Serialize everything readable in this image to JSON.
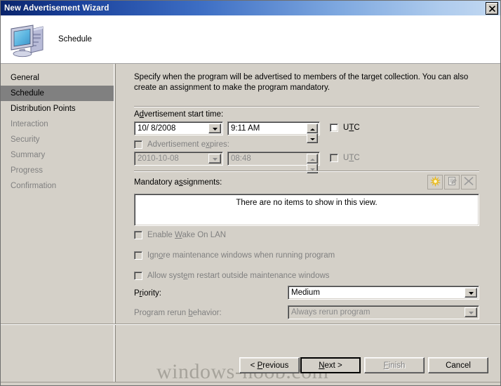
{
  "window": {
    "title": "New Advertisement Wizard",
    "close_icon": "close-icon"
  },
  "header": {
    "title": "Schedule",
    "icon": "computer-icon"
  },
  "sidebar": {
    "items": [
      {
        "label": "General",
        "state": "normal"
      },
      {
        "label": "Schedule",
        "state": "selected"
      },
      {
        "label": "Distribution Points",
        "state": "normal"
      },
      {
        "label": "Interaction",
        "state": "dim"
      },
      {
        "label": "Security",
        "state": "dim"
      },
      {
        "label": "Summary",
        "state": "dim"
      },
      {
        "label": "Progress",
        "state": "dim"
      },
      {
        "label": "Confirmation",
        "state": "dim"
      }
    ]
  },
  "content": {
    "intro": "Specify when the program will be advertised to members of the target collection. You can also create an assignment to make the program mandatory.",
    "start_time": {
      "label_pre": "A",
      "label_acc": "d",
      "label_post": "vertisement start time:",
      "date_value": "10/  8/2008",
      "time_value": "9:11 AM",
      "utc_label_pre": "U",
      "utc_label_acc": "T",
      "utc_label_post": "C",
      "utc_checked": false
    },
    "expires": {
      "label_pre": "Advertisement e",
      "label_acc": "x",
      "label_post": "pires:",
      "checked": false,
      "enabled": false,
      "date_value": "2010-10-08",
      "time_value": "08:48",
      "utc_label_pre": "U",
      "utc_label_acc": "T",
      "utc_label_post": "C",
      "utc_checked": false
    },
    "assignments": {
      "label_pre": "Mandatory a",
      "label_acc": "s",
      "label_post": "signments:",
      "empty_text": "There are no items to show in this view.",
      "toolbar": [
        {
          "name": "new-assignment-icon",
          "enabled": true
        },
        {
          "name": "properties-icon",
          "enabled": false
        },
        {
          "name": "delete-icon",
          "enabled": false
        }
      ]
    },
    "options": [
      {
        "name": "enable-wake-on-lan",
        "label_pre": "Enable ",
        "label_acc": "W",
        "label_post": "ake On LAN",
        "checked": false,
        "enabled": false
      },
      {
        "name": "ignore-maintenance-windows",
        "label_pre": "Ign",
        "label_acc": "o",
        "label_post": "re maintenance windows when running program",
        "checked": false,
        "enabled": false
      },
      {
        "name": "allow-system-restart",
        "label_pre": "Allow syst",
        "label_acc": "e",
        "label_post": "m restart outside maintenance windows",
        "checked": false,
        "enabled": false
      }
    ],
    "priority": {
      "label_pre": "P",
      "label_acc": "r",
      "label_post": "iority:",
      "value": "Medium",
      "enabled": true
    },
    "rerun": {
      "label_pre": "Program rerun ",
      "label_acc": "b",
      "label_post": "ehavior:",
      "value": "Always rerun program",
      "enabled": false
    }
  },
  "buttons": {
    "previous": {
      "pre": "< ",
      "acc": "P",
      "post": "revious",
      "enabled": true,
      "default": false
    },
    "next": {
      "pre": "",
      "acc": "N",
      "post": "ext >",
      "enabled": true,
      "default": true
    },
    "finish": {
      "pre": "",
      "acc": "F",
      "post": "inish",
      "enabled": false,
      "default": false
    },
    "cancel": {
      "pre": "",
      "acc": "",
      "post": "Cancel",
      "enabled": true,
      "default": false
    }
  },
  "watermark": {
    "text": "windows-noob.com"
  }
}
